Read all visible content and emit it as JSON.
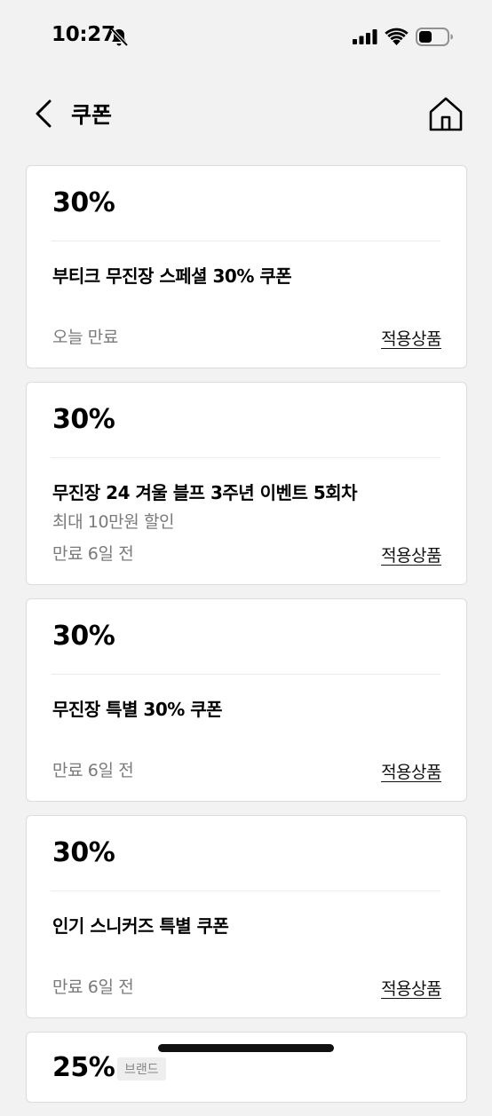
{
  "status_bar": {
    "time": "10:27"
  },
  "header": {
    "title": "쿠폰"
  },
  "coupons": [
    {
      "discount": "30%",
      "name": "부티크 무진장 스페셜 30% 쿠폰",
      "sub": "",
      "expiry": "오늘 만료",
      "link": "적용상품"
    },
    {
      "discount": "30%",
      "name": "무진장 24 겨울 블프 3주년 이벤트 5회차",
      "sub": "최대 10만원 할인",
      "expiry": "만료 6일 전",
      "link": "적용상품"
    },
    {
      "discount": "30%",
      "name": "무진장 특별 30% 쿠폰",
      "sub": "",
      "expiry": "만료 6일 전",
      "link": "적용상품"
    },
    {
      "discount": "30%",
      "name": "인기 스니커즈 특별 쿠폰",
      "sub": "",
      "expiry": "만료 6일 전",
      "link": "적용상품"
    }
  ],
  "partial_coupon": {
    "discount": "25%",
    "badge": "브랜드"
  }
}
